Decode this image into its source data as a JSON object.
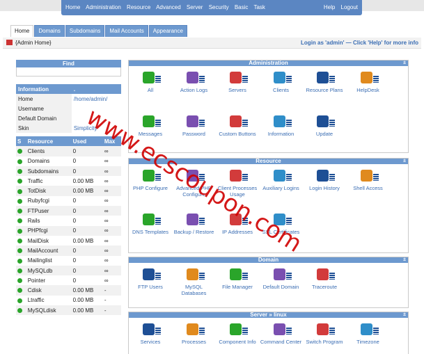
{
  "topnav": {
    "left": [
      "Home",
      "Administration",
      "Resource",
      "Advanced",
      "Server",
      "Security",
      "Basic",
      "Task"
    ],
    "right": [
      "Help",
      "Logout"
    ]
  },
  "tabs": [
    "Home",
    "Domains",
    "Subdomains",
    "Mail Accounts",
    "Appearance"
  ],
  "breadcrumb": "{Admin Home}",
  "login_text": "Login as 'admin' — Click 'Help' for more info",
  "find": {
    "title": "Find"
  },
  "information": {
    "header": "Information",
    "header_value": ".",
    "rows": [
      {
        "key": "Home",
        "value": "/home/admin/"
      },
      {
        "key": "Username",
        "value": ""
      },
      {
        "key": "Default Domain",
        "value": ""
      },
      {
        "key": "Skin",
        "value": "Simplicity"
      }
    ]
  },
  "resources": {
    "headers": [
      "S",
      "Resource",
      "Used",
      "Max"
    ],
    "rows": [
      {
        "name": "Clients",
        "used": "0",
        "max": "∞"
      },
      {
        "name": "Domains",
        "used": "0",
        "max": "∞"
      },
      {
        "name": "Subdomains",
        "used": "0",
        "max": "∞"
      },
      {
        "name": "Traffic",
        "used": "0.00 MB",
        "max": "∞"
      },
      {
        "name": "TotDisk",
        "used": "0.00 MB",
        "max": "∞"
      },
      {
        "name": "Rubyfcgi",
        "used": "0",
        "max": "∞"
      },
      {
        "name": "FTPuser",
        "used": "0",
        "max": "∞"
      },
      {
        "name": "Rails",
        "used": "0",
        "max": "∞"
      },
      {
        "name": "PHPfcgi",
        "used": "0",
        "max": "∞"
      },
      {
        "name": "MailDisk",
        "used": "0.00 MB",
        "max": "∞"
      },
      {
        "name": "MailAccount",
        "used": "0",
        "max": "∞"
      },
      {
        "name": "Mailinglist",
        "used": "0",
        "max": "∞"
      },
      {
        "name": "MySQLdb",
        "used": "0",
        "max": "∞"
      },
      {
        "name": "Pointer",
        "used": "0",
        "max": "∞"
      },
      {
        "name": "Cdisk",
        "used": "0.00 MB",
        "max": "-"
      },
      {
        "name": "Ltraffic",
        "used": "0.00 MB",
        "max": "-"
      },
      {
        "name": "MySQLdisk",
        "used": "0.00 MB",
        "max": "-"
      }
    ]
  },
  "panels": {
    "administration": {
      "title": "Administration",
      "toggle": "±",
      "items": [
        "All",
        "Action Logs",
        "Servers",
        "Clients",
        "Resource Plans",
        "HelpDesk",
        "Messages",
        "Password",
        "Custom Buttons",
        "Information",
        "Update"
      ]
    },
    "resource": {
      "title": "Resource",
      "toggle": "±",
      "items": [
        "PHP Configure",
        "Advanced PHP Configure",
        "Client Processes Usage",
        "Auxiliary Logins",
        "Login History",
        "Shell Access",
        "DNS Templates",
        "Backup / Restore",
        "IP Addresses",
        "SSL Certificates"
      ]
    },
    "domain": {
      "title": "Domain",
      "toggle": "±",
      "items": [
        "FTP Users",
        "MySQL Databases",
        "File Manager",
        "Default Domain",
        "Traceroute"
      ]
    },
    "server": {
      "title": "Server » linux",
      "toggle": "±",
      "items": [
        "Services",
        "Processes",
        "Component Info",
        "Command Center",
        "Switch Program",
        "Timezone"
      ]
    }
  },
  "watermark": "www.ecscoupon.com"
}
